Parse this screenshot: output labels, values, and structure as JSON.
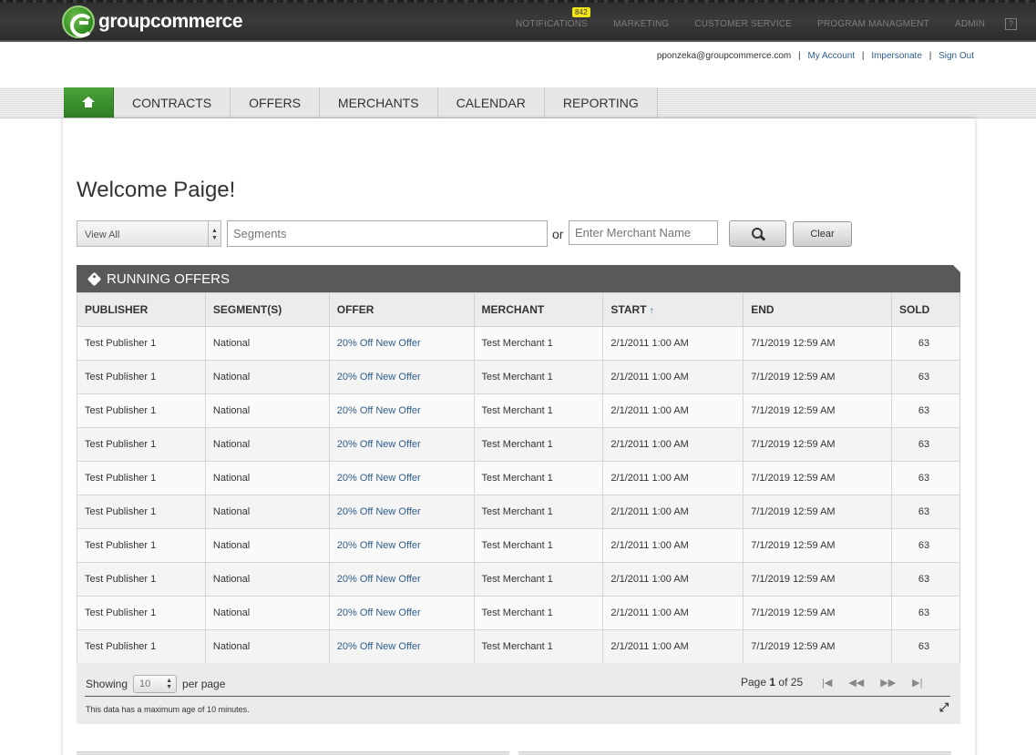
{
  "header": {
    "logo_text": "groupcommerce",
    "nav": [
      {
        "label": "NOTIFICATIONS",
        "badge": "842"
      },
      {
        "label": "MARKETING"
      },
      {
        "label": "CUSTOMER SERVICE"
      },
      {
        "label": "PROGRAM MANAGMENT"
      },
      {
        "label": "ADMIN"
      }
    ],
    "help_label": "?"
  },
  "userbar": {
    "email": "pponzeka@groupcommerce.com",
    "sep": "|",
    "links": [
      "My Account",
      "Impersonate",
      "Sign Out"
    ]
  },
  "mainnav": {
    "home_icon": "home-icon",
    "tabs": [
      "CONTRACTS",
      "OFFERS",
      "MERCHANTS",
      "CALENDAR",
      "REPORTING"
    ]
  },
  "page": {
    "title": "Welcome Paige!"
  },
  "filters": {
    "view_select": "View All",
    "segments_placeholder": "Segments",
    "or_label": "or",
    "merchant_placeholder": "Enter Merchant Name",
    "search_icon": "search-icon",
    "clear_label": "Clear"
  },
  "offers": {
    "title": "RUNNING OFFERS",
    "columns": [
      "PUBLISHER",
      "SEGMENT(S)",
      "OFFER",
      "MERCHANT",
      "START",
      "END",
      "SOLD"
    ],
    "sort_indicator": "↑",
    "rows": [
      [
        "Test Publisher 1",
        "National",
        "20% Off New Offer",
        "Test Merchant 1",
        "2/1/2011 1:00 AM",
        "7/1/2019 12:59 AM",
        "63"
      ],
      [
        "Test Publisher 1",
        "National",
        "20% Off New Offer",
        "Test Merchant 1",
        "2/1/2011 1:00 AM",
        "7/1/2019 12:59 AM",
        "63"
      ],
      [
        "Test Publisher 1",
        "National",
        "20% Off New Offer",
        "Test Merchant 1",
        "2/1/2011 1:00 AM",
        "7/1/2019 12:59 AM",
        "63"
      ],
      [
        "Test Publisher 1",
        "National",
        "20% Off New Offer",
        "Test Merchant 1",
        "2/1/2011 1:00 AM",
        "7/1/2019 12:59 AM",
        "63"
      ],
      [
        "Test Publisher 1",
        "National",
        "20% Off New Offer",
        "Test Merchant 1",
        "2/1/2011 1:00 AM",
        "7/1/2019 12:59 AM",
        "63"
      ],
      [
        "Test Publisher 1",
        "National",
        "20% Off New Offer",
        "Test Merchant 1",
        "2/1/2011 1:00 AM",
        "7/1/2019 12:59 AM",
        "63"
      ],
      [
        "Test Publisher 1",
        "National",
        "20% Off New Offer",
        "Test Merchant 1",
        "2/1/2011 1:00 AM",
        "7/1/2019 12:59 AM",
        "63"
      ],
      [
        "Test Publisher 1",
        "National",
        "20% Off New Offer",
        "Test Merchant 1",
        "2/1/2011 1:00 AM",
        "7/1/2019 12:59 AM",
        "63"
      ],
      [
        "Test Publisher 1",
        "National",
        "20% Off New Offer",
        "Test Merchant 1",
        "2/1/2011 1:00 AM",
        "7/1/2019 12:59 AM",
        "63"
      ],
      [
        "Test Publisher 1",
        "National",
        "20% Off New Offer",
        "Test Merchant 1",
        "2/1/2011 1:00 AM",
        "7/1/2019 12:59 AM",
        "63"
      ]
    ],
    "footer": {
      "showing_label": "Showing",
      "per_page_value": "10",
      "per_page_label": "per page",
      "page_label": "Page",
      "current_page": "1",
      "of_label": "of",
      "total_pages": "25",
      "pager_icons": [
        "first-page-icon",
        "prev-page-icon",
        "next-page-icon",
        "last-page-icon"
      ],
      "max_age_note": "This data has a maximum age of 10 minutes.",
      "expand_icon": "expand-icon"
    }
  },
  "colors": {
    "topbar": "#333333",
    "home_tab": "#3c8f2c",
    "link": "#2f5d8a",
    "section_header": "#595959",
    "badge": "#f2e51a"
  }
}
